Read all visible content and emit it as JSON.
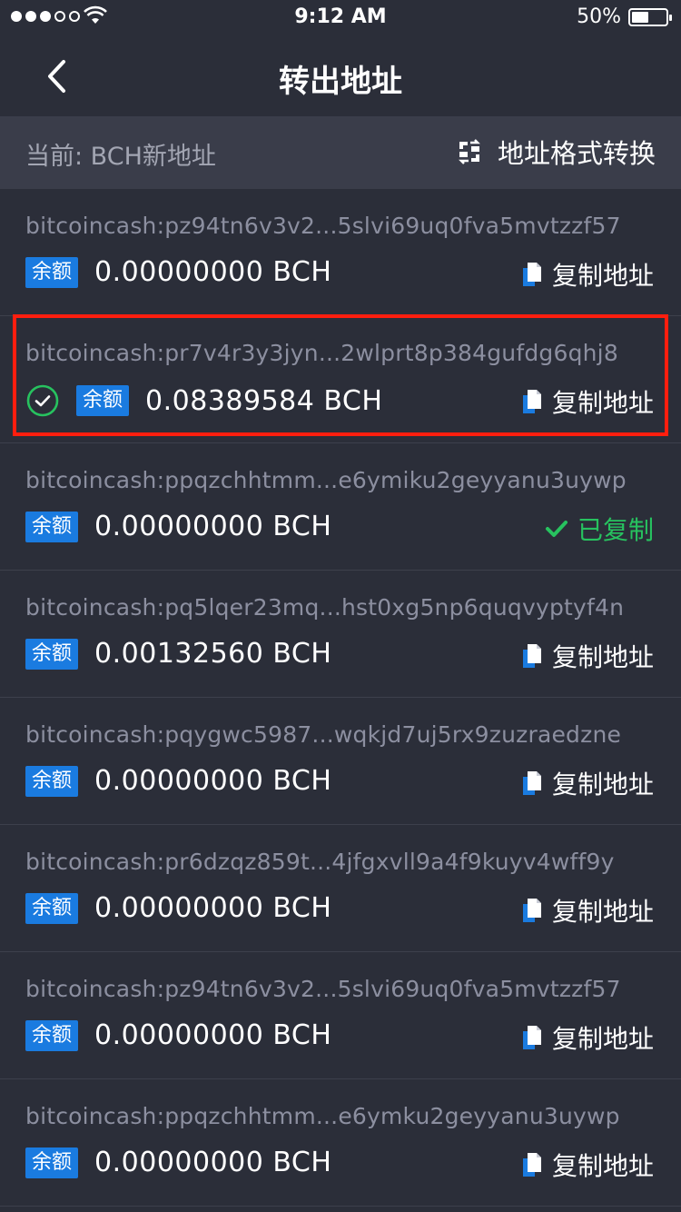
{
  "status_bar": {
    "time": "9:12 AM",
    "battery_percent": "50%",
    "battery_level": 0.5,
    "signal_bars_filled": 3,
    "signal_bars_total": 5,
    "icons": [
      "signal-dots-icon",
      "wifi-icon",
      "battery-icon"
    ]
  },
  "nav": {
    "title": "转出地址",
    "back_icon": "chevron-left-icon"
  },
  "subheader": {
    "current_label": "当前: BCH新地址",
    "format_toggle_label": "地址格式转换",
    "format_toggle_icon": "swap-icon"
  },
  "labels": {
    "balance_badge": "余额",
    "copy_address": "复制地址",
    "copied": "已复制"
  },
  "colors": {
    "background": "#2b2e39",
    "subheader_bg": "#3a3d4a",
    "badge_blue": "#1a7be0",
    "success_green": "#27c25f",
    "highlight_red": "#ff1e0e"
  },
  "addresses": [
    {
      "address": "bitcoincash:pz94tn6v3v2...5slvi69uq0fva5mvtzzf57",
      "balance": "0.00000000 BCH",
      "selected": false,
      "copied": false
    },
    {
      "address": "bitcoincash:pr7v4r3y3jyn...2wlprt8p384gufdg6qhj8",
      "balance": "0.08389584 BCH",
      "selected": true,
      "copied": false
    },
    {
      "address": "bitcoincash:ppqzchhtmm...e6ymiku2geyyanu3uywp",
      "balance": "0.00000000 BCH",
      "selected": false,
      "copied": true
    },
    {
      "address": "bitcoincash:pq5lqer23mq...hst0xg5np6quqvyptyf4n",
      "balance": "0.00132560 BCH",
      "selected": false,
      "copied": false
    },
    {
      "address": "bitcoincash:pqygwc5987...wqkjd7uj5rx9zuzraedzne",
      "balance": "0.00000000 BCH",
      "selected": false,
      "copied": false
    },
    {
      "address": "bitcoincash:pr6dzqz859t...4jfgxvll9a4f9kuyv4wff9y",
      "balance": "0.00000000 BCH",
      "selected": false,
      "copied": false
    },
    {
      "address": "bitcoincash:pz94tn6v3v2...5slvi69uq0fva5mvtzzf57",
      "balance": "0.00000000 BCH",
      "selected": false,
      "copied": false
    },
    {
      "address": "bitcoincash:ppqzchhtmm...e6ymku2geyyanu3uywp",
      "balance": "0.00000000 BCH",
      "selected": false,
      "copied": false
    }
  ]
}
